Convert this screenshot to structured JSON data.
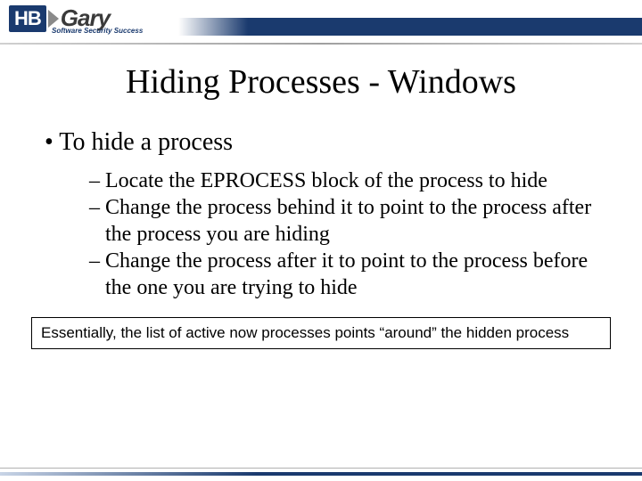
{
  "header": {
    "logo_left": "HB",
    "logo_right": "Gary",
    "tagline": "Software Security Success"
  },
  "slide": {
    "title": "Hiding Processes - Windows",
    "main_bullet": "To hide a process",
    "sub_bullets": [
      "Locate the EPROCESS block of the process to hide",
      "Change the process behind it to point to the process after the process you are hiding",
      "Change the process after it to point to the process before the one you are trying to hide"
    ],
    "note": "Essentially, the list of active now processes points “around” the hidden process"
  }
}
